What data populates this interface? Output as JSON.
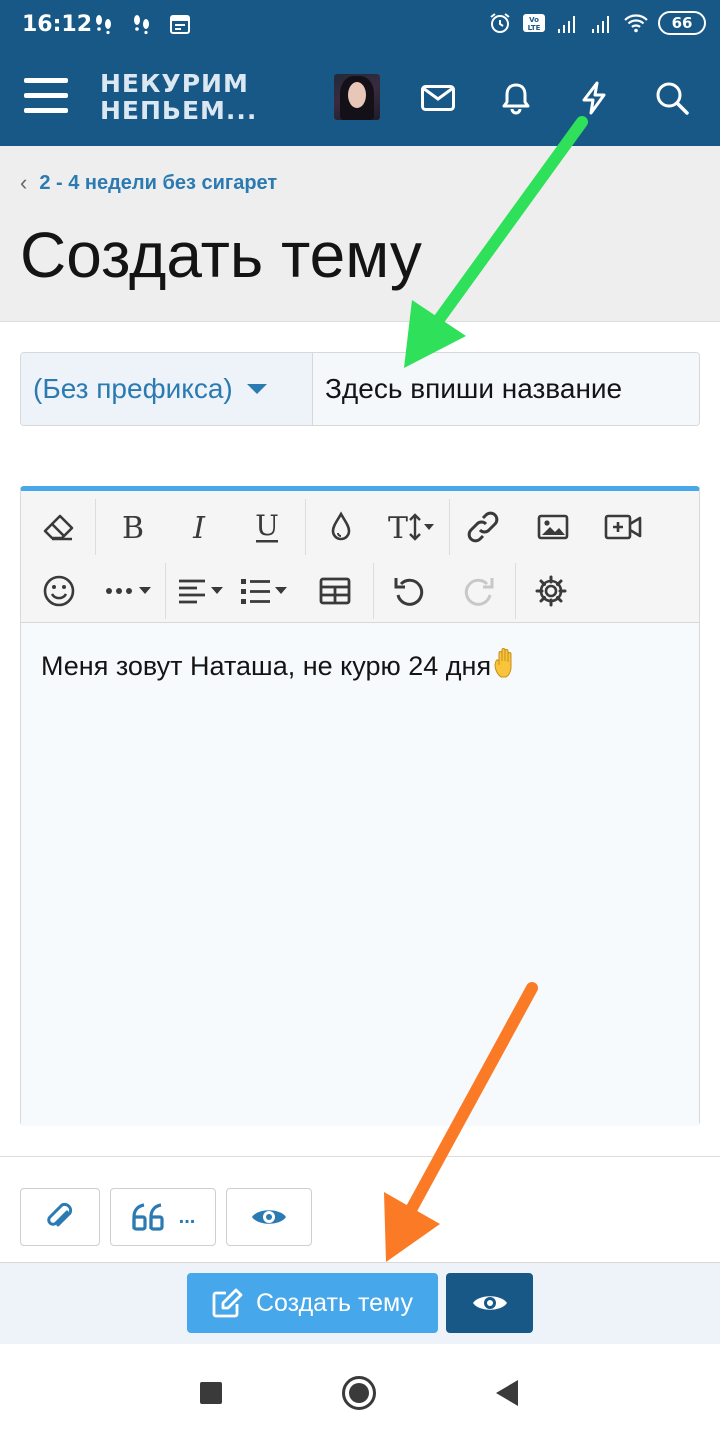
{
  "status_bar": {
    "time": "16:12",
    "battery": "66"
  },
  "header": {
    "logo_line1": "НЕКУРИМ",
    "logo_line2": "НЕПЬЕМ..."
  },
  "breadcrumb": {
    "label": "2 - 4 недели без сигарет"
  },
  "page": {
    "title": "Создать тему"
  },
  "thread_form": {
    "prefix_selected": "(Без префикса)",
    "title_value": "Здесь впиши название"
  },
  "editor": {
    "body_text": "Меня зовут Наташа, не курю 24 дня"
  },
  "actions": {
    "quote_label": "..."
  },
  "submit": {
    "label": "Создать тему"
  },
  "colors": {
    "brand": "#185886",
    "accent": "#47a7eb",
    "link": "#2b7ab2",
    "annotation_green": "#2ee05a",
    "annotation_orange": "#fb7a26"
  }
}
